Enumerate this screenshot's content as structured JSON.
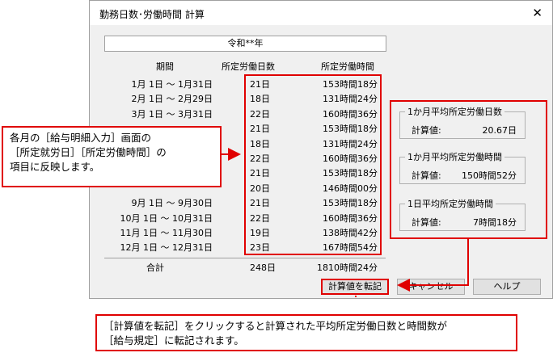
{
  "dialog": {
    "title": "勤務日数･労働時間 計算",
    "close_glyph": "✕",
    "year": "令和**年",
    "headers": {
      "period": "期間",
      "days": "所定労働日数",
      "hours": "所定労働時間"
    },
    "rows": [
      {
        "period": "1月 1日 ～  1月31日",
        "days": "21日",
        "hours": "153時間18分"
      },
      {
        "period": "2月 1日 ～  2月29日",
        "days": "18日",
        "hours": "131時間24分"
      },
      {
        "period": "3月 1日 ～  3月31日",
        "days": "22日",
        "hours": "160時間36分"
      },
      {
        "period": "",
        "days": "21日",
        "hours": "153時間18分"
      },
      {
        "period": "",
        "days": "18日",
        "hours": "131時間24分"
      },
      {
        "period": "",
        "days": "22日",
        "hours": "160時間36分"
      },
      {
        "period": "",
        "days": "21日",
        "hours": "153時間18分"
      },
      {
        "period": "",
        "days": "20日",
        "hours": "146時間00分"
      },
      {
        "period": "9月 1日 ～  9月30日",
        "days": "21日",
        "hours": "153時間18分"
      },
      {
        "period": "10月 1日 ～ 10月31日",
        "days": "22日",
        "hours": "160時間36分"
      },
      {
        "period": "11月 1日 ～ 11月30日",
        "days": "19日",
        "hours": "138時間42分"
      },
      {
        "period": "12月 1日 ～ 12月31日",
        "days": "23日",
        "hours": "167時間54分"
      }
    ],
    "total": {
      "label": "合計",
      "days": "248日",
      "hours": "1810時間24分"
    },
    "groups": [
      {
        "title": "1か月平均所定労働日数",
        "label": "計算値:",
        "value": "20.67日"
      },
      {
        "title": "1か月平均所定労働時間",
        "label": "計算値:",
        "value": "150時間52分"
      },
      {
        "title": "1日平均所定労働時間",
        "label": "計算値:",
        "value": "7時間18分"
      }
    ],
    "buttons": {
      "transfer": "計算値を転記",
      "cancel": "キャンセル",
      "help": "ヘルプ"
    }
  },
  "callout_left": {
    "line1": "各月の［給与明細入力］画面の",
    "line2": "［所定就労日］［所定労働時間］の",
    "line3": "項目に反映します。"
  },
  "callout_bottom": {
    "line1": "［計算値を転記］をクリックすると計算された平均所定労働日数と時間数が",
    "line2": "［給与規定］に転記されます。"
  },
  "colors": {
    "highlight": "#e00000",
    "dialog_bg": "#f0f0f0"
  }
}
